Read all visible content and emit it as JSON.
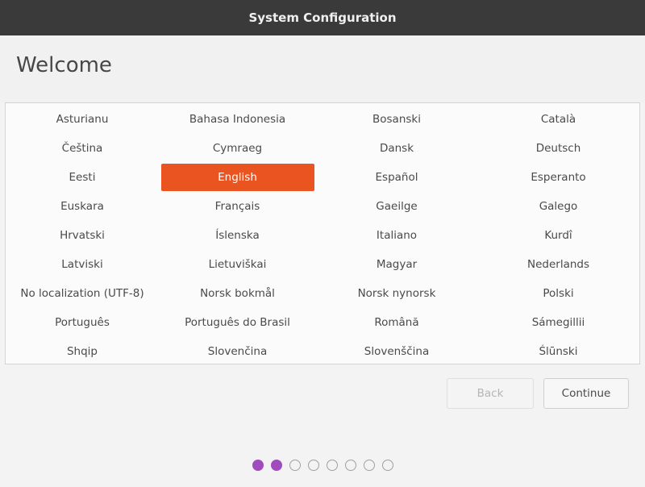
{
  "window": {
    "title": "System Configuration"
  },
  "page": {
    "title": "Welcome"
  },
  "languages": [
    "Asturianu",
    "Bahasa Indonesia",
    "Bosanski",
    "Català",
    "Čeština",
    "Cymraeg",
    "Dansk",
    "Deutsch",
    "Eesti",
    "English",
    "Español",
    "Esperanto",
    "Euskara",
    "Français",
    "Gaeilge",
    "Galego",
    "Hrvatski",
    "Íslenska",
    "Italiano",
    "Kurdî",
    "Latviski",
    "Lietuviškai",
    "Magyar",
    "Nederlands",
    "No localization (UTF-8)",
    "Norsk bokmål",
    "Norsk nynorsk",
    "Polski",
    "Português",
    "Português do Brasil",
    "Română",
    "Sámegillii",
    "Shqip",
    "Slovenčina",
    "Slovenščina",
    "Ślūnski"
  ],
  "selected_language": "English",
  "buttons": {
    "back": "Back",
    "continue": "Continue"
  },
  "progress": {
    "total_steps": 8,
    "completed_steps": 2
  },
  "colors": {
    "accent": "#e95420",
    "progress_dot": "#a04cbc",
    "titlebar": "#3a3a3a"
  }
}
